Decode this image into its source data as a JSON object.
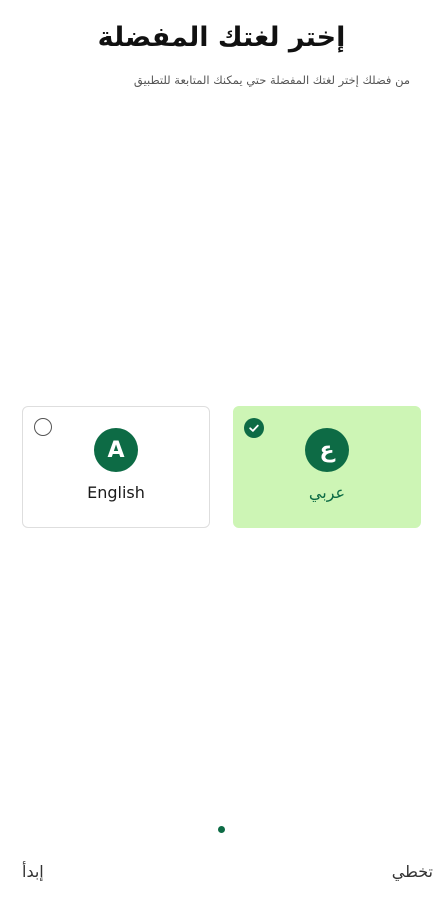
{
  "header": {
    "title": "إختر لغتك المفضلة",
    "subtitle": "من فضلك إختر لغتك المفضلة حتي يمكنك المتابعة للتطبيق"
  },
  "languages": [
    {
      "letter": "ع",
      "label": "عربي",
      "selected": true
    },
    {
      "letter": "A",
      "label": "English",
      "selected": false
    }
  ],
  "pager": {
    "current": 1,
    "total": 1
  },
  "footer": {
    "skip_label": "تخطي",
    "start_label": "إبدأ"
  },
  "colors": {
    "accent": "#0d6b45",
    "selected_card_bg": "#cdf5b5",
    "card_border": "#dedede"
  },
  "icons": {
    "selected": "check-circle-icon",
    "unselected": "radio-empty-icon"
  }
}
